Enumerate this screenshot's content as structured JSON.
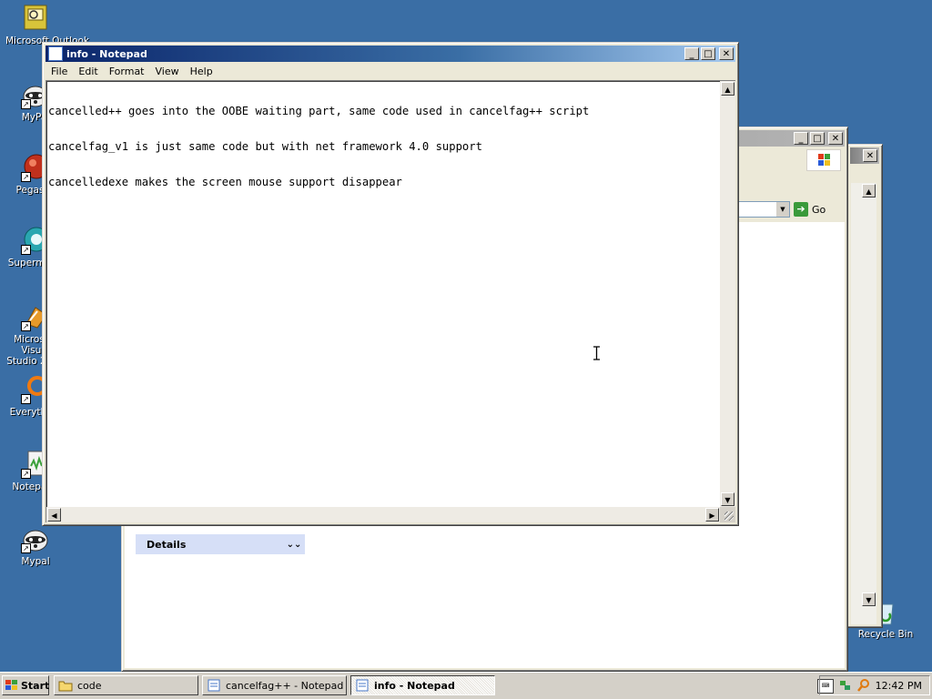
{
  "desktop": {
    "icons": [
      {
        "label": "Microsoft Outlook",
        "icon": "outlook-icon"
      },
      {
        "label": "MyPal",
        "icon": "mypal-icon"
      },
      {
        "label": "Pegasus",
        "icon": "pegasus-icon"
      },
      {
        "label": "Supermium",
        "icon": "supermium-icon"
      },
      {
        "label": "Microsoft Visual Studio 2008",
        "icon": "visual-studio-icon"
      },
      {
        "label": "Everything",
        "icon": "everything-icon"
      },
      {
        "label": "Notepad2",
        "icon": "notepad-icon"
      },
      {
        "label": "Mypal",
        "icon": "mypal-icon"
      },
      {
        "label": "Recycle Bin",
        "icon": "recycle-bin-icon"
      }
    ]
  },
  "notepad": {
    "title": "info - Notepad",
    "menu": [
      "File",
      "Edit",
      "Format",
      "View",
      "Help"
    ],
    "lines": [
      "cancelled++ goes into the OOBE waiting part, same code used in cancelfag++ script",
      "cancelfag_v1 is just same code but with net framework 4.0 support",
      "cancelledexe makes the screen mouse support disappear"
    ]
  },
  "explorer": {
    "go_label": "Go",
    "details_label": "Details"
  },
  "taskbar": {
    "start_label": "Start",
    "buttons": [
      {
        "label": "code",
        "icon": "folder-icon"
      },
      {
        "label": "cancelfag++ - Notepad",
        "icon": "notepad-icon"
      },
      {
        "label": "info - Notepad",
        "icon": "notepad-icon"
      }
    ],
    "clock": "12:42 PM"
  }
}
